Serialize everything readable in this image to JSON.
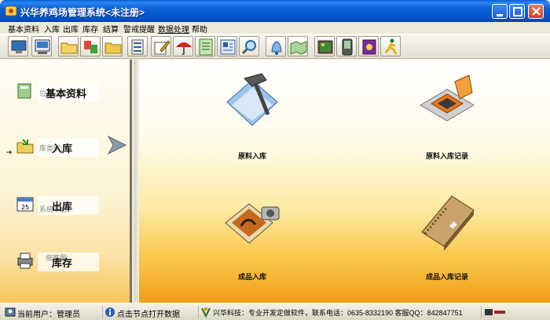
{
  "window": {
    "title": "兴华养鸡场管理系统<未注册>"
  },
  "menu": {
    "items": [
      "基本资料",
      "入库",
      "出库",
      "库存",
      "结算",
      "警戒提醒",
      "数据处理",
      "帮助"
    ]
  },
  "nav": {
    "items": [
      {
        "label": "基本资料",
        "ghost": "位置         原料"
      },
      {
        "label": "入库",
        "ghost": "          库类别:"
      },
      {
        "label": "出库",
        "ghost": "          系统平台:"
      },
      {
        "label": "库存",
        "ghost": "         缩略图:"
      }
    ]
  },
  "tiles": [
    {
      "label": "原料入库",
      "icon": "hammer-document-icon"
    },
    {
      "label": "原料入库记录",
      "icon": "chip-icon"
    },
    {
      "label": "成品入库",
      "icon": "photo-camera-icon"
    },
    {
      "label": "成品入库记录",
      "icon": "notebook-icon"
    }
  ],
  "status": {
    "user": "当前用户：管理员",
    "hint": "点击节点打开数据",
    "company": "兴华科技：专业开发定做软件，联系电话：0635-8332190  客服QQ：842847751"
  },
  "colors": {
    "titlebar": "#0a5fd8",
    "panel_border": "#7a7566",
    "accent_orange": "#f29e1a"
  }
}
